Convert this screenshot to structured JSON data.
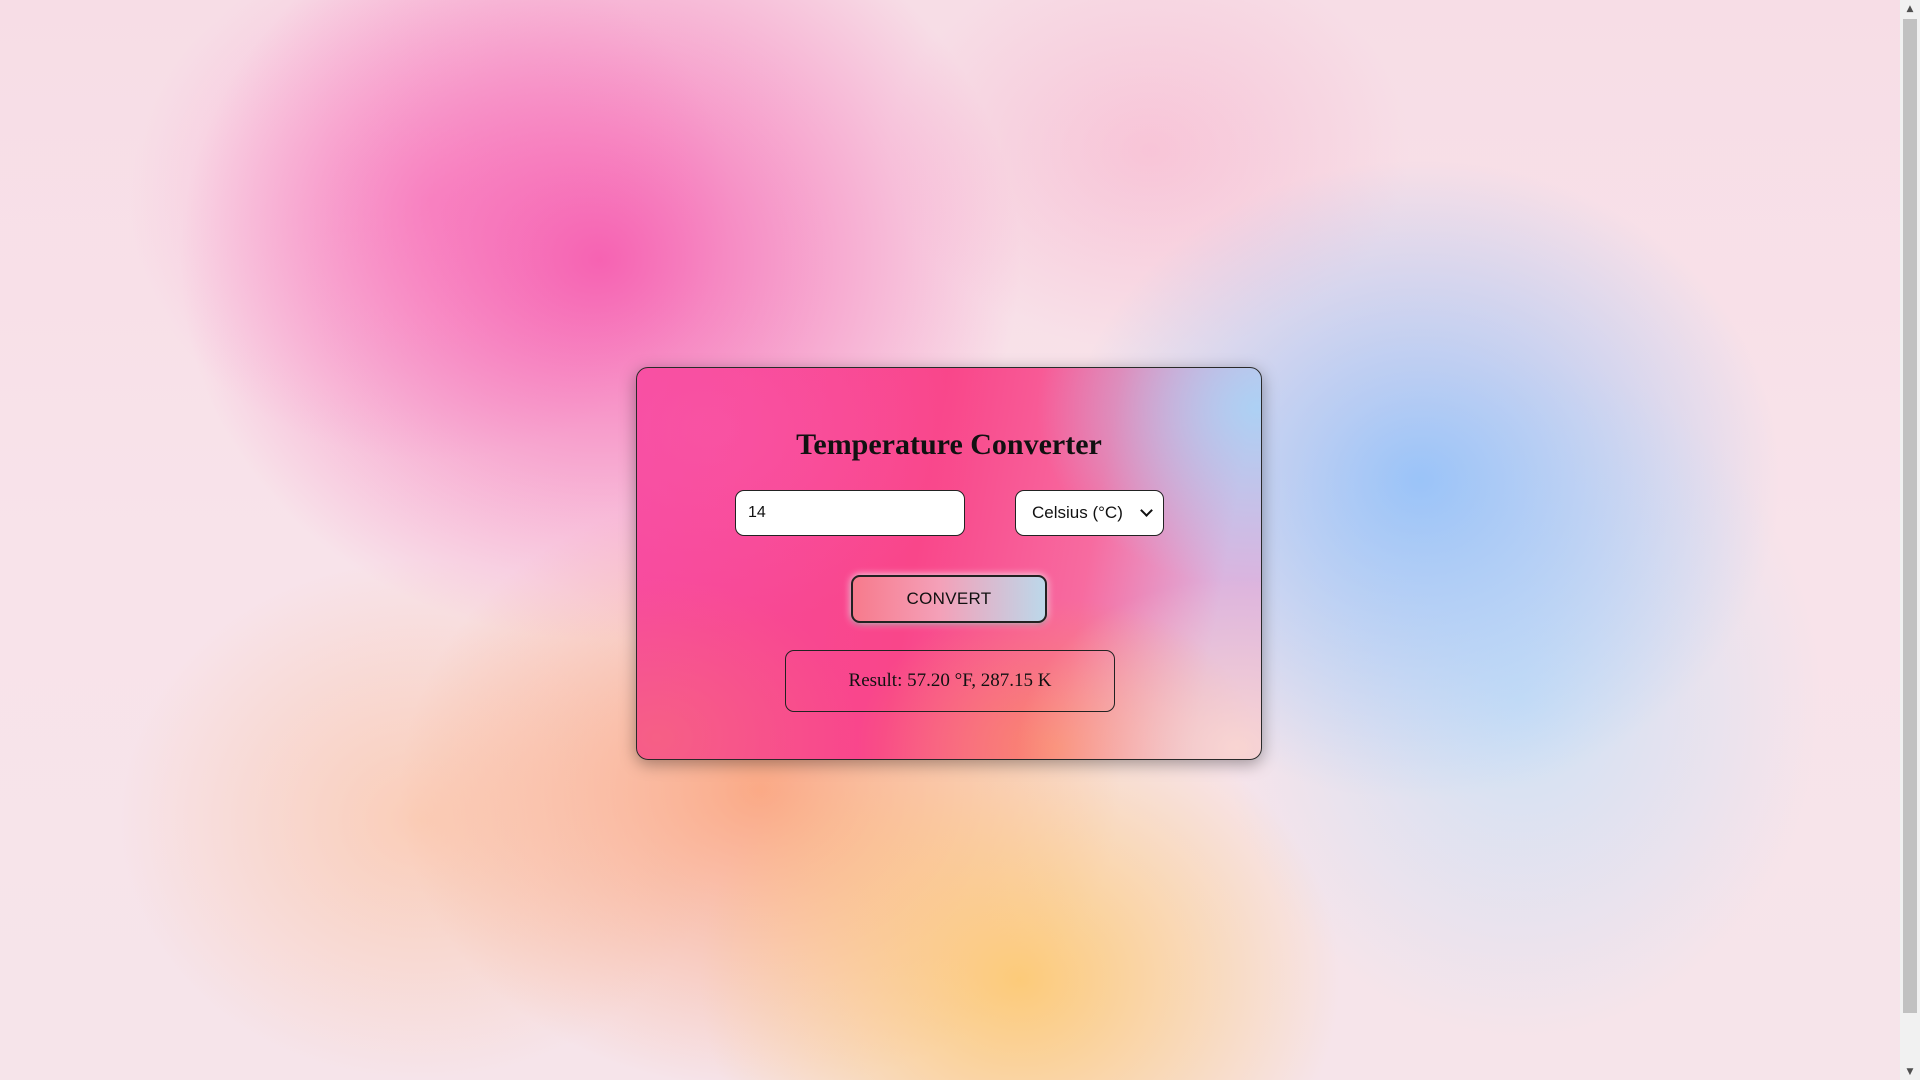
{
  "app": {
    "title": "Temperature Converter"
  },
  "form": {
    "temperature_value": "14",
    "unit_selected": "Celsius (°C)",
    "convert_label": "CONVERT"
  },
  "result": {
    "text": "Result: 57.20 °F, 287.15 K"
  },
  "icons": {
    "select_arrow": "chevron-down-icon",
    "scroll_up": "scroll-up-arrow-icon",
    "scroll_down": "scroll-down-arrow-icon"
  },
  "colors": {
    "card_pink": "#f9468a",
    "card_blue": "#aad2f5",
    "card_orange": "#fa8c64",
    "button_start": "#f77a8c",
    "button_end": "#bcd8ea"
  }
}
